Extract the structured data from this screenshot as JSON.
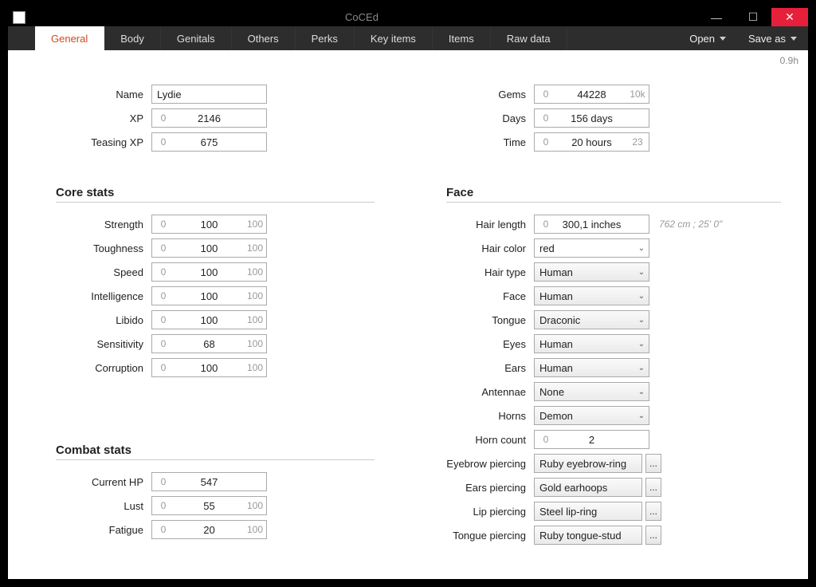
{
  "window_title": "CoCEd",
  "version": "0.9h",
  "tabs": [
    "General",
    "Body",
    "Genitals",
    "Others",
    "Perks",
    "Key items",
    "Items",
    "Raw data"
  ],
  "menu": {
    "open": "Open",
    "save_as": "Save as"
  },
  "basic": {
    "name_label": "Name",
    "name_value": "Lydie",
    "xp_label": "XP",
    "xp_low": "0",
    "xp_value": "2146",
    "teasexp_label": "Teasing XP",
    "teasexp_low": "0",
    "teasexp_value": "675",
    "gems_label": "Gems",
    "gems_low": "0",
    "gems_value": "44228",
    "gems_high": "10k",
    "days_label": "Days",
    "days_low": "0",
    "days_value": "156 days",
    "time_label": "Time",
    "time_low": "0",
    "time_value": "20 hours",
    "time_high": "23"
  },
  "core_head": "Core stats",
  "core": [
    {
      "label": "Strength",
      "low": "0",
      "value": "100",
      "high": "100"
    },
    {
      "label": "Toughness",
      "low": "0",
      "value": "100",
      "high": "100"
    },
    {
      "label": "Speed",
      "low": "0",
      "value": "100",
      "high": "100"
    },
    {
      "label": "Intelligence",
      "low": "0",
      "value": "100",
      "high": "100"
    },
    {
      "label": "Libido",
      "low": "0",
      "value": "100",
      "high": "100"
    },
    {
      "label": "Sensitivity",
      "low": "0",
      "value": "68",
      "high": "100"
    },
    {
      "label": "Corruption",
      "low": "0",
      "value": "100",
      "high": "100"
    }
  ],
  "combat_head": "Combat stats",
  "combat": [
    {
      "label": "Current HP",
      "low": "0",
      "value": "547",
      "high": ""
    },
    {
      "label": "Lust",
      "low": "0",
      "value": "55",
      "high": "100"
    },
    {
      "label": "Fatigue",
      "low": "0",
      "value": "20",
      "high": "100"
    }
  ],
  "face_head": "Face",
  "face": {
    "hair_length_label": "Hair length",
    "hair_length_low": "0",
    "hair_length_value": "300,1 inches",
    "hair_length_hint": "762 cm ; 25' 0\"",
    "hair_color_label": "Hair color",
    "hair_color_value": "red",
    "hair_type_label": "Hair type",
    "hair_type_value": "Human",
    "face_label": "Face",
    "face_value": "Human",
    "tongue_label": "Tongue",
    "tongue_value": "Draconic",
    "eyes_label": "Eyes",
    "eyes_value": "Human",
    "ears_label": "Ears",
    "ears_value": "Human",
    "antennae_label": "Antennae",
    "antennae_value": "None",
    "horns_label": "Horns",
    "horns_value": "Demon",
    "horn_count_label": "Horn count",
    "horn_count_low": "0",
    "horn_count_value": "2",
    "eyebrow_p_label": "Eyebrow piercing",
    "eyebrow_p_value": "Ruby eyebrow-ring",
    "ears_p_label": "Ears piercing",
    "ears_p_value": "Gold earhoops",
    "lip_p_label": "Lip piercing",
    "lip_p_value": "Steel lip-ring",
    "tongue_p_label": "Tongue piercing",
    "tongue_p_value": "Ruby tongue-stud"
  },
  "dots": "..."
}
